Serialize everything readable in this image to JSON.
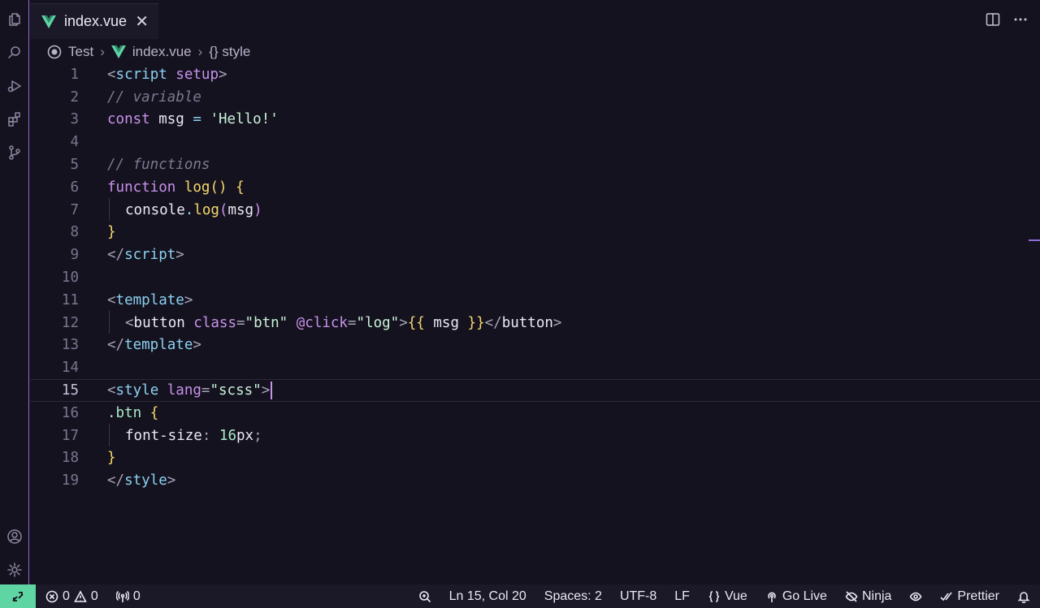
{
  "tab": {
    "label": "index.vue",
    "close": "✕"
  },
  "breadcrumb": {
    "root": "Test",
    "file": "index.vue",
    "symbol": "{} style"
  },
  "code_lines": [
    {
      "n": "1"
    },
    {
      "n": "2"
    },
    {
      "n": "3"
    },
    {
      "n": "4"
    },
    {
      "n": "5"
    },
    {
      "n": "6"
    },
    {
      "n": "7"
    },
    {
      "n": "8"
    },
    {
      "n": "9"
    },
    {
      "n": "10"
    },
    {
      "n": "11"
    },
    {
      "n": "12"
    },
    {
      "n": "13"
    },
    {
      "n": "14"
    },
    {
      "n": "15"
    },
    {
      "n": "16"
    },
    {
      "n": "17"
    },
    {
      "n": "18"
    },
    {
      "n": "19"
    }
  ],
  "code": {
    "l1": {
      "open": "<",
      "tag": "script",
      "attr": " setup",
      "close": ">"
    },
    "l2": {
      "comment": "// variable"
    },
    "l3": {
      "kw": "const",
      "var": " msg ",
      "op": "=",
      "str": " 'Hello!'"
    },
    "l5": {
      "comment": "// functions"
    },
    "l6": {
      "kw": "function",
      "fn": " log",
      "paren": "()",
      "brace": " {"
    },
    "l7": {
      "obj": "console",
      "dot": ".",
      "fn": "log",
      "p1": "(",
      "arg": "msg",
      "p2": ")"
    },
    "l8": {
      "brace": "}"
    },
    "l9": {
      "open": "</",
      "tag": "script",
      "close": ">"
    },
    "l11": {
      "open": "<",
      "tag": "template",
      "close": ">"
    },
    "l12": {
      "open": "<",
      "tag": "button",
      "a1": " class",
      "eq1": "=",
      "s1": "\"btn\"",
      "a2": " @click",
      "eq2": "=",
      "s2": "\"log\"",
      "close": ">",
      "m1": "{{",
      "mv": " msg ",
      "m2": "}}",
      "open2": "</",
      "tag2": "button",
      "close2": ">"
    },
    "l13": {
      "open": "</",
      "tag": "template",
      "close": ">"
    },
    "l15": {
      "open": "<",
      "tag": "style",
      "a1": " lang",
      "eq": "=",
      "s1": "\"scss\"",
      "close": ">"
    },
    "l16": {
      "sel": ".btn",
      "brace": " {"
    },
    "l17": {
      "prop": "font-size",
      "colon": ": ",
      "num": "16",
      "unit": "px",
      "semi": ";"
    },
    "l18": {
      "brace": "}"
    },
    "l19": {
      "open": "</",
      "tag": "style",
      "close": ">"
    }
  },
  "status": {
    "errors": "0",
    "warnings": "0",
    "ports": "0",
    "position": "Ln 15, Col 20",
    "spaces": "Spaces: 2",
    "encoding": "UTF-8",
    "eol": "LF",
    "language": "Vue",
    "golive": "Go Live",
    "ninja": "Ninja",
    "prettier": "Prettier"
  },
  "colors": {
    "accent": "#8f6bd8",
    "remote": "#5fd5a3",
    "background": "#15121f"
  },
  "icons": [
    "files-icon",
    "search-icon",
    "run-debug-icon",
    "extensions-icon",
    "source-control-icon",
    "account-icon",
    "settings-gear-icon",
    "split-editor-icon",
    "more-actions-icon",
    "vue-icon",
    "remote-icon",
    "error-icon",
    "warning-icon",
    "ports-icon",
    "zoom-icon",
    "broadcast-icon",
    "eye-slash-icon",
    "eye-icon",
    "double-check-icon",
    "bell-icon"
  ]
}
